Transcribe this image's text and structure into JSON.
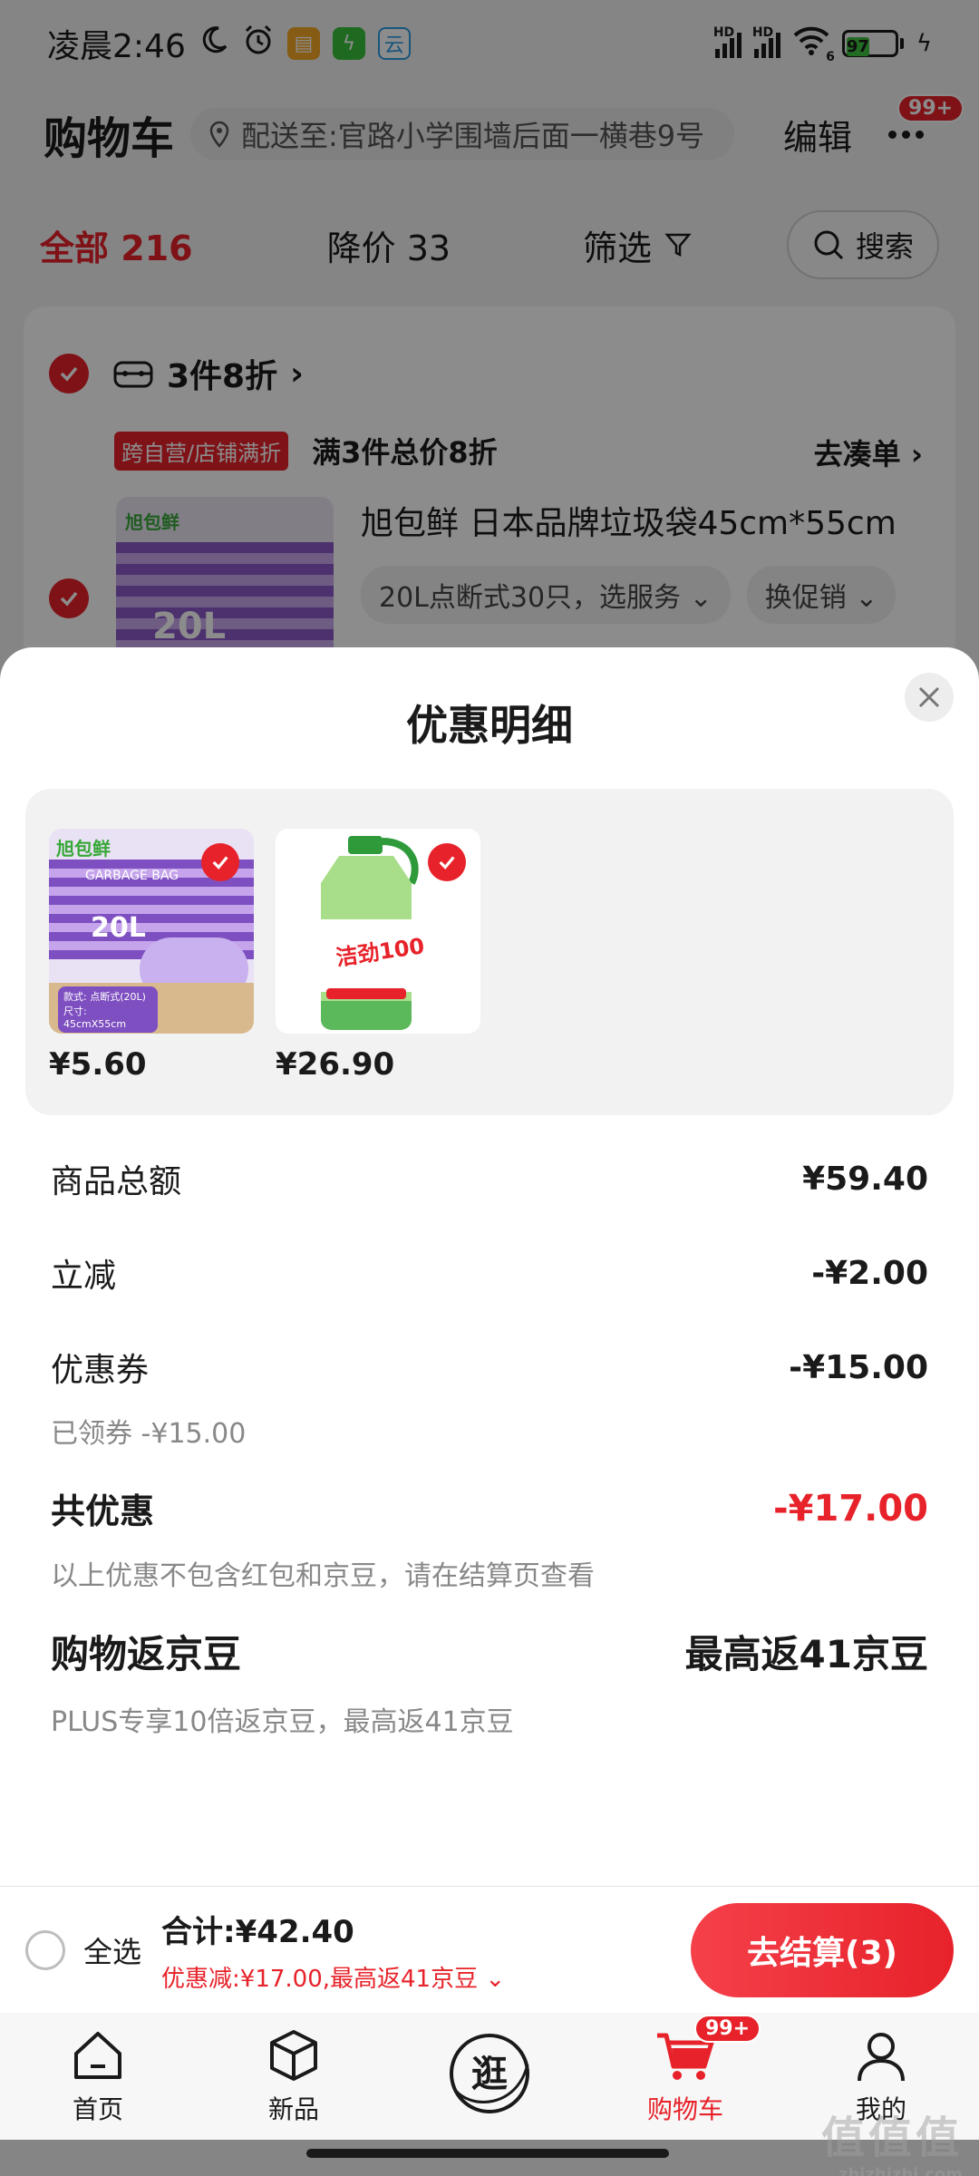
{
  "status_bar": {
    "time": "凌晨2:46",
    "network_1": "HD",
    "network_2": "HD",
    "wifi_badge": "6",
    "battery": "97"
  },
  "header": {
    "title": "购物车",
    "address": "配送至:官路小学围墙后面一横巷9号",
    "edit_label": "编辑",
    "more_badge": "99+"
  },
  "tabs": {
    "all_label": "全部",
    "all_count": "216",
    "price_drop_label": "降价",
    "price_drop_count": "33",
    "filter_label": "筛选",
    "search_label": "搜索"
  },
  "cart_group": {
    "promo_title": "3件8折",
    "promo_tag": "跨自营/店铺满折",
    "promo_desc": "满3件总价8折",
    "goto_label": "去凑单",
    "item_title": "旭包鲜 日本品牌垃圾袋45cm*55cm",
    "item_spec": "20L点断式30只，选服务",
    "item_promo_switch": "换促销",
    "thumb_brand": "旭包鲜",
    "thumb_size": "20L"
  },
  "sheet": {
    "title": "优惠明细",
    "goods": [
      {
        "price": "¥5.60",
        "thumb_brand": "旭包鲜",
        "thumb_text": "GARBAGE BAG",
        "thumb_size": "20L",
        "thumb_caption": "款式: 点断式(20L) 尺寸: 45cmX55cm"
      },
      {
        "price": "¥26.90",
        "thumb_brand": "洁劲100"
      }
    ],
    "rows": {
      "subtotal_label": "商品总额",
      "subtotal_value": "¥59.40",
      "instant_label": "立减",
      "instant_value": "-¥2.00",
      "coupon_label": "优惠券",
      "coupon_value": "-¥15.00",
      "coupon_sub": "已领券 -¥15.00",
      "total_label": "共优惠",
      "total_value": "-¥17.00",
      "total_note": "以上优惠不包含红包和京豆，请在结算页查看",
      "bean_label": "购物返京豆",
      "bean_value": "最高返41京豆",
      "bean_note": "PLUS专享10倍返京豆，最高返41京豆"
    }
  },
  "bottom_bar": {
    "select_all": "全选",
    "total": "合计:¥42.40",
    "discount_note": "优惠减:¥17.00,最高返41京豆",
    "checkout": "去结算(3)"
  },
  "nav": {
    "items": [
      {
        "label": "首页"
      },
      {
        "label": "新品"
      },
      {
        "label": "逛"
      },
      {
        "label": "购物车",
        "badge": "99+"
      },
      {
        "label": "我的"
      }
    ]
  },
  "watermark": {
    "text": "值值值",
    "site": "zhizhizhi.com"
  },
  "colors": {
    "accent_red": "#e7222a",
    "battery_green": "#3ec43e"
  }
}
